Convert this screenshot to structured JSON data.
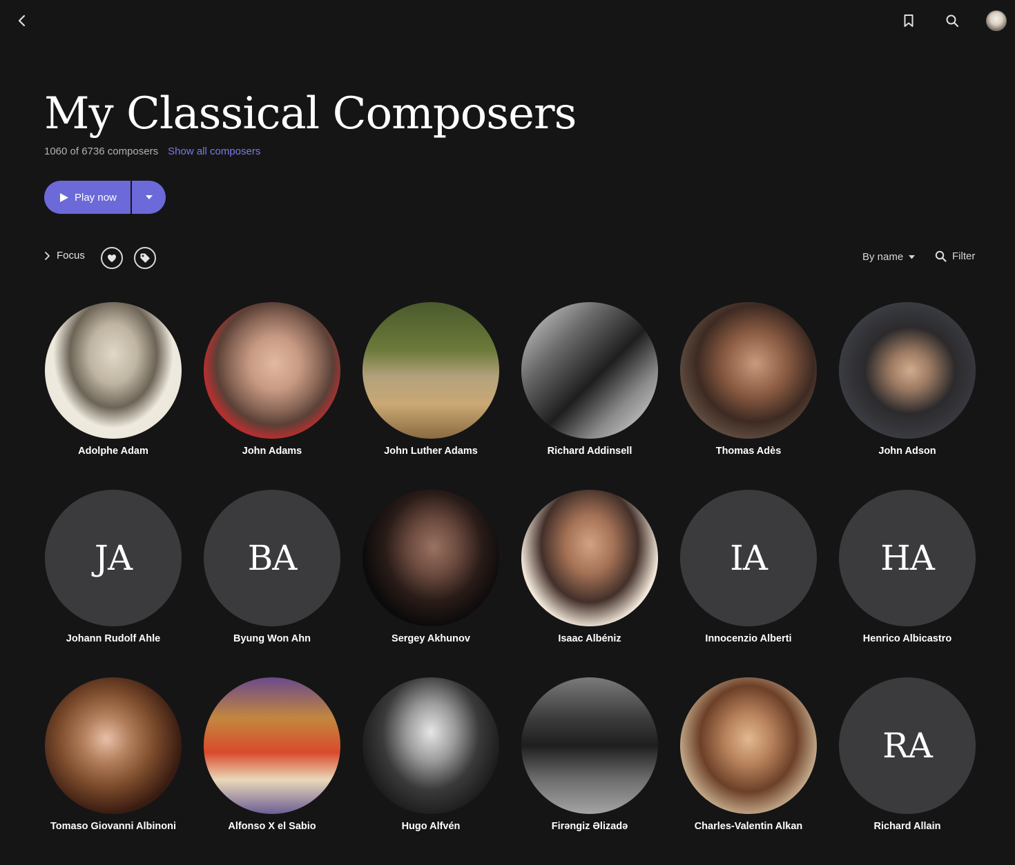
{
  "header": {
    "back_icon": "chevron-left-icon",
    "bookmark_icon": "bookmark-icon",
    "search_icon": "search-icon"
  },
  "page": {
    "title": "My Classical Composers",
    "count_text": "1060 of 6736 composers",
    "show_all_link": "Show all composers"
  },
  "play": {
    "label": "Play now",
    "accent_color": "#6c69d9"
  },
  "toolbar": {
    "focus_label": "Focus",
    "sort_label": "By name",
    "filter_label": "Filter"
  },
  "composers": [
    {
      "name": "Adolphe Adam",
      "initials": "",
      "has_photo": true
    },
    {
      "name": "John Adams",
      "initials": "",
      "has_photo": true
    },
    {
      "name": "John Luther Adams",
      "initials": "",
      "has_photo": true
    },
    {
      "name": "Richard Addinsell",
      "initials": "",
      "has_photo": true
    },
    {
      "name": "Thomas Adès",
      "initials": "",
      "has_photo": true
    },
    {
      "name": "John Adson",
      "initials": "",
      "has_photo": true
    },
    {
      "name": "Johann Rudolf Ahle",
      "initials": "JA",
      "has_photo": false
    },
    {
      "name": "Byung Won Ahn",
      "initials": "BA",
      "has_photo": false
    },
    {
      "name": "Sergey Akhunov",
      "initials": "",
      "has_photo": true
    },
    {
      "name": "Isaac Albéniz",
      "initials": "",
      "has_photo": true
    },
    {
      "name": "Innocenzio Alberti",
      "initials": "IA",
      "has_photo": false
    },
    {
      "name": "Henrico Albicastro",
      "initials": "HA",
      "has_photo": false
    },
    {
      "name": "Tomaso Giovanni Albinoni",
      "initials": "",
      "has_photo": true
    },
    {
      "name": "Alfonso X el Sabio",
      "initials": "",
      "has_photo": true
    },
    {
      "name": "Hugo Alfvén",
      "initials": "",
      "has_photo": true
    },
    {
      "name": "Firəngiz Əlizadə",
      "initials": "",
      "has_photo": true
    },
    {
      "name": "Charles-Valentin Alkan",
      "initials": "",
      "has_photo": true
    },
    {
      "name": "Richard Allain",
      "initials": "RA",
      "has_photo": false
    }
  ]
}
